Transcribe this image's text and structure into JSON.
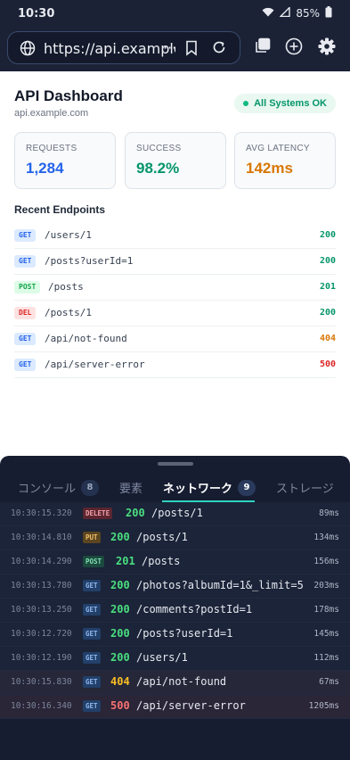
{
  "status_bar": {
    "time": "10:30",
    "battery": "85%"
  },
  "browser": {
    "url": "https://api.example",
    "ellipsis": "···"
  },
  "page": {
    "title": "API Dashboard",
    "subtitle": "api.example.com",
    "status_pill": "All Systems OK",
    "cards": [
      {
        "label": "REQUESTS",
        "value": "1,284",
        "color": "#2563eb"
      },
      {
        "label": "SUCCESS",
        "value": "98.2%",
        "color": "#059669"
      },
      {
        "label": "AVG LATENCY",
        "value": "142ms",
        "color": "#d97706"
      }
    ],
    "section_title": "Recent Endpoints",
    "endpoints": [
      {
        "method": "GET",
        "path": "/users/1",
        "code": "200",
        "code_color": "#059669"
      },
      {
        "method": "GET",
        "path": "/posts?userId=1",
        "code": "200",
        "code_color": "#059669"
      },
      {
        "method": "POST",
        "path": "/posts",
        "code": "201",
        "code_color": "#059669"
      },
      {
        "method": "DEL",
        "path": "/posts/1",
        "code": "200",
        "code_color": "#059669"
      },
      {
        "method": "GET",
        "path": "/api/not-found",
        "code": "404",
        "code_color": "#d97706"
      },
      {
        "method": "GET",
        "path": "/api/server-error",
        "code": "500",
        "code_color": "#dc2626"
      }
    ]
  },
  "devtools": {
    "tabs": [
      {
        "label": "コンソール",
        "badge": "8"
      },
      {
        "label": "要素",
        "badge": ""
      },
      {
        "label": "ネットワーク",
        "badge": "9"
      },
      {
        "label": "ストレージ",
        "badge": ""
      }
    ],
    "active_tab": "ネットワーク",
    "requests": [
      {
        "time": "10:30:15.320",
        "method": "DELETE",
        "status": "200",
        "path": "/posts/1",
        "duration": "89ms"
      },
      {
        "time": "10:30:14.810",
        "method": "PUT",
        "status": "200",
        "path": "/posts/1",
        "duration": "134ms"
      },
      {
        "time": "10:30:14.290",
        "method": "POST",
        "status": "201",
        "path": "/posts",
        "duration": "156ms"
      },
      {
        "time": "10:30:13.780",
        "method": "GET",
        "status": "200",
        "path": "/photos?albumId=1&_limit=5",
        "duration": "203ms"
      },
      {
        "time": "10:30:13.250",
        "method": "GET",
        "status": "200",
        "path": "/comments?postId=1",
        "duration": "178ms"
      },
      {
        "time": "10:30:12.720",
        "method": "GET",
        "status": "200",
        "path": "/posts?userId=1",
        "duration": "145ms"
      },
      {
        "time": "10:30:12.190",
        "method": "GET",
        "status": "200",
        "path": "/users/1",
        "duration": "112ms"
      },
      {
        "time": "10:30:15.830",
        "method": "GET",
        "status": "404",
        "path": "/api/not-found",
        "duration": "67ms"
      },
      {
        "time": "10:30:16.340",
        "method": "GET",
        "status": "500",
        "path": "/api/server-error",
        "duration": "1205ms"
      }
    ]
  }
}
